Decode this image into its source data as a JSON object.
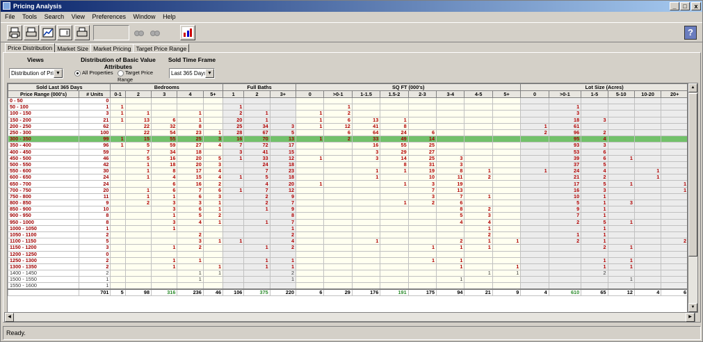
{
  "window": {
    "title": "Pricing Analysis",
    "controls": [
      "_",
      "□",
      "x"
    ]
  },
  "menu": [
    "File",
    "Tools",
    "Search",
    "View",
    "Preferences",
    "Window",
    "Help"
  ],
  "tabs": [
    "Price Distribution",
    "Market Size",
    "Market Pricing",
    "Target Price Range"
  ],
  "controls": {
    "views_title": "Views",
    "views_value": "Distribution of Prices",
    "dist_title": "Distribution of Basic Value Attributes",
    "radio_all": "All Properties",
    "radio_target": "Target Price Range",
    "time_title": "Sold Time Frame",
    "time_value": "Last 365 Days"
  },
  "grid": {
    "group_headers": [
      "Sold Last 365 Days",
      "Bedrooms",
      "Full Baths",
      "SQ FT (000's)",
      "Lot Size (Acres)"
    ],
    "col_headers": [
      "Price Range (000's)",
      "# Units",
      "0-1",
      "2",
      "3",
      "4",
      "5+",
      "1",
      "2",
      "3+",
      "0",
      ">0-1",
      "1-1.5",
      "1.5-2",
      "2-3",
      "3-4",
      "4-5",
      "5+",
      "0",
      ">0-1",
      "1-5",
      "5-10",
      "10-20",
      "20+"
    ],
    "rows": [
      [
        "0 - 50",
        "0",
        "",
        "",
        "",
        "",
        "",
        "",
        "",
        "",
        "",
        "",
        "",
        "",
        "",
        "",
        "",
        "",
        "",
        "",
        "",
        "",
        "",
        ""
      ],
      [
        "50 - 100",
        "1",
        "1",
        "",
        "",
        "",
        "",
        "1",
        "",
        "",
        "",
        "1",
        "",
        "",
        "",
        "",
        "",
        "",
        "",
        "1",
        "",
        "",
        "",
        ""
      ],
      [
        "100 - 150",
        "3",
        "1",
        "1",
        "",
        "1",
        "",
        "2",
        "1",
        "",
        "1",
        "2",
        "",
        "",
        "",
        "",
        "",
        "",
        "",
        "3",
        "",
        "",
        "",
        ""
      ],
      [
        "150 - 200",
        "21",
        "1",
        "13",
        "6",
        "1",
        "",
        "20",
        "1",
        "",
        "1",
        "6",
        "13",
        "1",
        "",
        "",
        "",
        "",
        "",
        "18",
        "3",
        "",
        "",
        ""
      ],
      [
        "200 - 250",
        "62",
        "",
        "22",
        "32",
        "8",
        "",
        "25",
        "34",
        "3",
        "1",
        "12",
        "41",
        "8",
        "",
        "",
        "",
        "",
        "1",
        "61",
        "",
        "",
        "",
        ""
      ],
      [
        "250 - 300",
        "100",
        "",
        "22",
        "54",
        "23",
        "1",
        "28",
        "67",
        "5",
        "",
        "6",
        "64",
        "24",
        "6",
        "",
        "",
        "",
        "2",
        "96",
        "2",
        "",
        "",
        ""
      ],
      [
        "300 - 350",
        "99",
        "1",
        "15",
        "55",
        "25",
        "3",
        "16",
        "70",
        "13",
        "1",
        "2",
        "33",
        "49",
        "14",
        "",
        "",
        "",
        "",
        "95",
        "4",
        "",
        "",
        ""
      ],
      [
        "350 - 400",
        "96",
        "1",
        "5",
        "59",
        "27",
        "4",
        "7",
        "72",
        "17",
        "",
        "",
        "16",
        "55",
        "25",
        "",
        "",
        "",
        "",
        "93",
        "3",
        "",
        "",
        ""
      ],
      [
        "400 - 450",
        "59",
        "",
        "7",
        "34",
        "18",
        "",
        "3",
        "41",
        "15",
        "",
        "",
        "3",
        "29",
        "27",
        "",
        "",
        "",
        "",
        "53",
        "6",
        "",
        "",
        ""
      ],
      [
        "450 - 500",
        "46",
        "",
        "5",
        "16",
        "20",
        "5",
        "1",
        "33",
        "12",
        "1",
        "",
        "3",
        "14",
        "25",
        "3",
        "",
        "",
        "",
        "39",
        "6",
        "1",
        "",
        ""
      ],
      [
        "500 - 550",
        "42",
        "",
        "1",
        "18",
        "20",
        "3",
        "",
        "24",
        "18",
        "",
        "",
        "",
        "8",
        "31",
        "3",
        "",
        "",
        "",
        "37",
        "5",
        "",
        "",
        ""
      ],
      [
        "550 - 600",
        "30",
        "",
        "1",
        "8",
        "17",
        "4",
        "",
        "7",
        "23",
        "",
        "",
        "1",
        "1",
        "19",
        "8",
        "1",
        "",
        "1",
        "24",
        "4",
        "",
        "1",
        ""
      ],
      [
        "600 - 650",
        "24",
        "",
        "1",
        "4",
        "15",
        "4",
        "1",
        "5",
        "18",
        "",
        "",
        "1",
        "",
        "10",
        "11",
        "2",
        "",
        "",
        "21",
        "2",
        "",
        "1",
        ""
      ],
      [
        "650 - 700",
        "24",
        "",
        "",
        "6",
        "16",
        "2",
        "",
        "4",
        "20",
        "1",
        "",
        "",
        "1",
        "3",
        "19",
        "",
        "",
        "",
        "17",
        "5",
        "1",
        "",
        "1"
      ],
      [
        "700 - 750",
        "20",
        "",
        "1",
        "6",
        "7",
        "6",
        "1",
        "7",
        "12",
        "",
        "",
        "",
        "",
        "7",
        "13",
        "",
        "",
        "",
        "16",
        "3",
        "",
        "",
        "1"
      ],
      [
        "750 - 800",
        "11",
        "",
        "1",
        "1",
        "6",
        "3",
        "",
        "2",
        "9",
        "",
        "",
        "",
        "",
        "3",
        "7",
        "1",
        "",
        "",
        "10",
        "1",
        "",
        "",
        ""
      ],
      [
        "800 - 850",
        "9",
        "",
        "2",
        "3",
        "3",
        "1",
        "",
        "2",
        "7",
        "",
        "",
        "",
        "1",
        "2",
        "6",
        "",
        "",
        "",
        "5",
        "1",
        "3",
        "",
        ""
      ],
      [
        "850 - 900",
        "10",
        "",
        "",
        "3",
        "6",
        "1",
        "",
        "1",
        "9",
        "",
        "",
        "",
        "",
        "",
        "8",
        "2",
        "",
        "",
        "9",
        "1",
        "",
        "",
        ""
      ],
      [
        "900 - 950",
        "8",
        "",
        "",
        "1",
        "5",
        "2",
        "",
        "",
        "8",
        "",
        "",
        "",
        "",
        "",
        "5",
        "3",
        "",
        "",
        "7",
        "1",
        "",
        "",
        ""
      ],
      [
        "950 - 1000",
        "8",
        "",
        "",
        "3",
        "4",
        "1",
        "",
        "1",
        "7",
        "",
        "",
        "",
        "",
        "",
        "4",
        "4",
        "",
        "",
        "2",
        "5",
        "1",
        "",
        ""
      ],
      [
        "1000 - 1050",
        "1",
        "",
        "",
        "1",
        "",
        "",
        "",
        "",
        "1",
        "",
        "",
        "",
        "",
        "",
        "",
        "1",
        "",
        "",
        "",
        "1",
        "",
        "",
        ""
      ],
      [
        "1050 - 1100",
        "2",
        "",
        "",
        "",
        "2",
        "",
        "",
        "",
        "2",
        "",
        "",
        "",
        "",
        "",
        "",
        "2",
        "",
        "",
        "1",
        "1",
        "",
        "",
        ""
      ],
      [
        "1100 - 1150",
        "5",
        "",
        "",
        "",
        "3",
        "1",
        "1",
        "",
        "4",
        "",
        "",
        "1",
        "",
        "",
        "2",
        "1",
        "1",
        "",
        "2",
        "1",
        "",
        "",
        "2"
      ],
      [
        "1150 - 1200",
        "3",
        "",
        "",
        "1",
        "2",
        "",
        "",
        "1",
        "2",
        "",
        "",
        "",
        "",
        "1",
        "1",
        "1",
        "",
        "",
        "",
        "2",
        "1",
        "",
        ""
      ],
      [
        "1200 - 1250",
        "0",
        "",
        "",
        "",
        "",
        "",
        "",
        "",
        "",
        "",
        "",
        "",
        "",
        "",
        "",
        "",
        "",
        "",
        "",
        "",
        "",
        "",
        ""
      ],
      [
        "1250 - 1300",
        "2",
        "",
        "",
        "1",
        "1",
        "",
        "",
        "1",
        "1",
        "",
        "",
        "",
        "",
        "1",
        "1",
        "",
        "",
        "",
        "",
        "1",
        "1",
        "",
        ""
      ],
      [
        "1300 - 1350",
        "2",
        "",
        "",
        "1",
        "",
        "1",
        "",
        "1",
        "1",
        "",
        "",
        "",
        "",
        "",
        "1",
        "",
        "1",
        "",
        "",
        "1",
        "1",
        "",
        ""
      ],
      [
        "1400 - 1450",
        "2",
        "",
        "",
        "",
        "1",
        "1",
        "",
        "",
        "2",
        "",
        "",
        "",
        "",
        "",
        "",
        "1",
        "1",
        "",
        "",
        "2",
        "",
        "",
        ""
      ],
      [
        "1500 - 1550",
        "1",
        "",
        "",
        "",
        "1",
        "",
        "",
        "",
        "1",
        "",
        "",
        "",
        "",
        "",
        "1",
        "",
        "",
        "",
        "",
        "",
        "1",
        "",
        ""
      ],
      [
        "1550 - 1600",
        "1",
        "",
        "",
        "",
        "",
        "",
        "",
        "",
        "",
        "",
        "",
        "",
        "",
        "",
        "",
        "",
        "",
        "",
        "",
        "",
        "",
        "",
        ""
      ]
    ],
    "totals": [
      "",
      "701",
      "5",
      "98",
      "316",
      "236",
      "46",
      "106",
      "375",
      "220",
      "6",
      "29",
      "176",
      "191",
      "175",
      "94",
      "21",
      "9",
      "4",
      "610",
      "65",
      "12",
      "4",
      "6"
    ],
    "highlight_row": "300 - 350"
  },
  "status": "Ready."
}
